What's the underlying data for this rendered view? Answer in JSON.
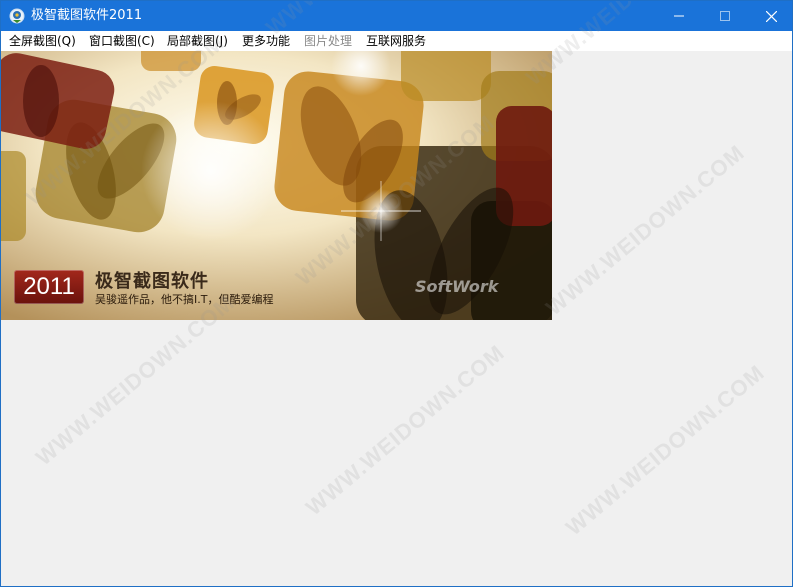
{
  "window": {
    "title": "极智截图软件2011",
    "icon": "app-logo-icon",
    "controls": [
      "minimize-icon",
      "maximize-icon",
      "close-icon"
    ]
  },
  "menu": {
    "items": [
      {
        "label": "全屏截图(Q)",
        "enabled": true
      },
      {
        "label": "窗口截图(C)",
        "enabled": true
      },
      {
        "label": "局部截图(J)",
        "enabled": true
      },
      {
        "label": "更多功能",
        "enabled": true
      },
      {
        "label": "图片处理",
        "enabled": false
      },
      {
        "label": "互联网服务",
        "enabled": true
      }
    ]
  },
  "banner": {
    "year": "2011",
    "product_name": "极智截图软件",
    "slogan": "吴骏遥作品，他不搞I.T，但酷爱编程",
    "brand": "SoftWork"
  },
  "watermark": {
    "text": "WWW.WEIDOWN.COM"
  },
  "colors": {
    "titlebar": "#1a73d9",
    "menubar": "#ffffff",
    "client": "#f0f0f0",
    "badge": "#8b1c12"
  }
}
